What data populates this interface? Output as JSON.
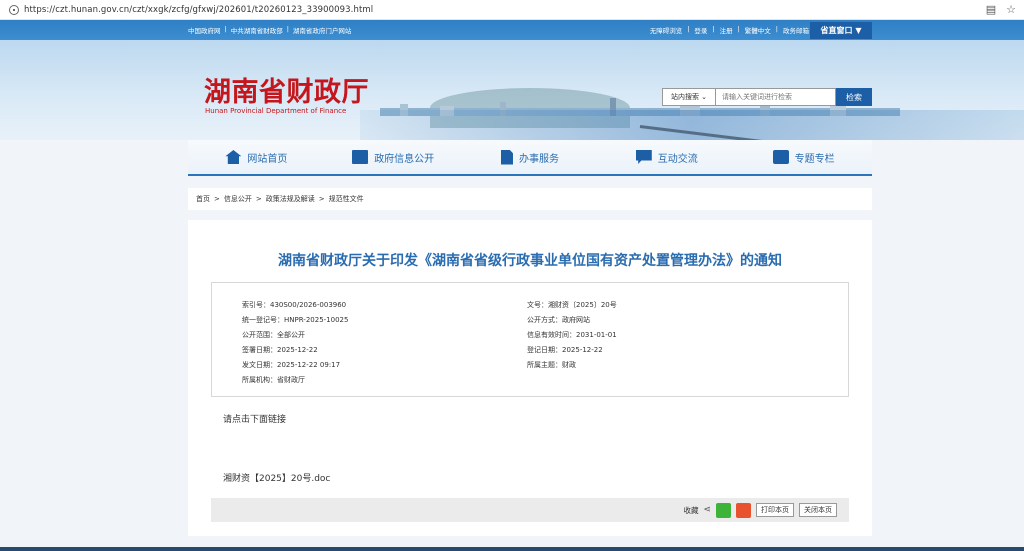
{
  "browser": {
    "url": "https://czt.hunan.gov.cn/czt/xxgk/zcfg/gfxwj/202601/t20260123_33900093.html"
  },
  "topbar": {
    "left_links": [
      "中国政府网",
      "|",
      "中共湖南省财政部",
      "|",
      "湖南省政府门户网站"
    ],
    "right_links": [
      "无障碍浏览",
      "|",
      "登录",
      "|",
      "注册",
      "|",
      "繁體中文",
      "|",
      "政务邮箱"
    ],
    "portal_label": "省直窗口 ▼"
  },
  "header": {
    "title": "湖南省财政厅",
    "subtitle": "Hunan Provincial Department of Finance",
    "search_scope": "站内搜索 ⌄",
    "search_placeholder": "请输入关键词进行检索",
    "search_button": "检索"
  },
  "nav": {
    "items": [
      {
        "label": "网站首页",
        "icon": "home-icon"
      },
      {
        "label": "政府信息公开",
        "icon": "book-icon"
      },
      {
        "label": "办事服务",
        "icon": "document-icon"
      },
      {
        "label": "互动交流",
        "icon": "chat-icon"
      },
      {
        "label": "专题专栏",
        "icon": "picture-icon"
      }
    ]
  },
  "breadcrumb": {
    "items": [
      "首页",
      ">",
      "信息公开",
      ">",
      "政策法规及解读",
      ">",
      "规范性文件"
    ]
  },
  "document": {
    "title": "湖南省财政厅关于印发《湖南省省级行政事业单位国有资产处置管理办法》的通知",
    "meta_left": [
      "索引号：430S00/2026-003960",
      "统一登记号：HNPR-2025-10025",
      "公开范围：全部公开",
      "签署日期：2025-12-22",
      "发文日期：2025-12-22 09:17",
      "所属机构：省财政厅"
    ],
    "meta_right": [
      "文号：湘财资〔2025〕20号",
      "公开方式：政府网站",
      "信息有效时间：2031-01-01",
      "登记日期：2025-12-22",
      "所属主题：财政"
    ],
    "body": "请点击下面链接",
    "attachment": "湘财资【2025】20号.doc"
  },
  "toolbar": {
    "favorite": "收藏",
    "print": "打印本页",
    "close": "关闭本页"
  }
}
